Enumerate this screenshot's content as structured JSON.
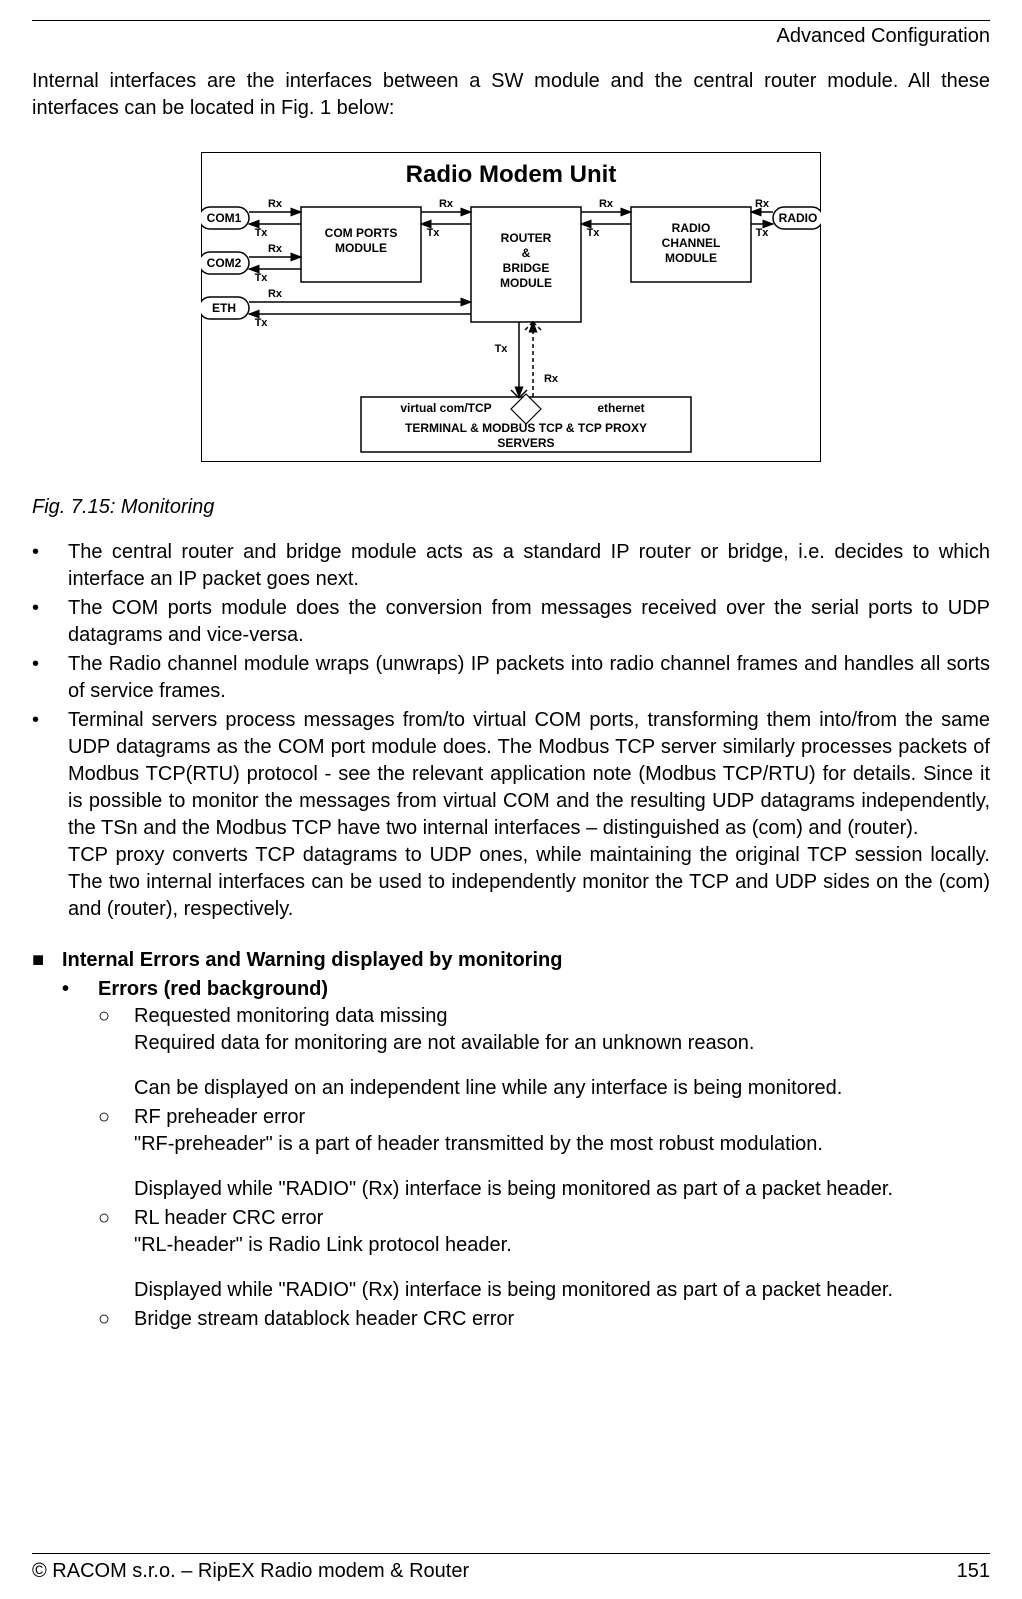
{
  "header": "Advanced Configuration",
  "intro": "Internal interfaces are the interfaces between a SW module and the central router module. All these interfaces can be located in Fig. 1 below:",
  "figure": {
    "title": "Radio Modem Unit",
    "ports": {
      "com1": "COM1",
      "com2": "COM2",
      "eth": "ETH",
      "radio": "RADIO"
    },
    "modules": {
      "com_ports": "COM PORTS MODULE",
      "router": "ROUTER & BRIDGE MODULE",
      "radio_channel": "RADIO CHANNEL MODULE",
      "servers": "TERMINAL & MODBUS TCP & TCP PROXY SERVERS"
    },
    "labels": {
      "rx": "Rx",
      "tx": "Tx",
      "virtual": "virtual com/TCP",
      "ethernet": "ethernet"
    },
    "caption": "Fig. 7.15: Monitoring"
  },
  "bullets": [
    "The central router and bridge module acts as a standard IP router or bridge, i.e. decides to which interface an IP packet goes next.",
    "The COM ports module does the conversion from messages received over the serial ports to UDP datagrams and vice-versa.",
    "The Radio channel module wraps (unwraps) IP packets into radio channel frames and handles all sorts of service frames.",
    "Terminal servers process messages from/to virtual COM ports, transforming them into/from the same UDP datagrams as the COM port module does. The Modbus TCP server similarly processes packets of Modbus TCP(RTU) protocol - see the relevant application note (Modbus TCP/RTU) for details. Since it is possible to monitor the messages from virtual COM and the resulting UDP datagrams independently, the TSn and the Modbus TCP have two internal interfaces – distinguished as (com) and (router).",
    "TCP proxy converts TCP datagrams to UDP ones, while maintaining the original TCP session locally. The two internal interfaces can be used to independently monitor the TCP and UDP sides on the (com) and (router), respectively."
  ],
  "section": {
    "heading": "Internal Errors and Warning displayed by monitoring",
    "sub": "Errors (red background)",
    "items": [
      {
        "title": "Requested monitoring data missing",
        "line1": "Required data for monitoring are not available for an unknown reason.",
        "line2": "Can be displayed on an independent line while any interface is being monitored."
      },
      {
        "title": "RF preheader error",
        "line1": "\"RF-preheader\" is a part of header transmitted by the most robust modulation.",
        "line2": "Displayed while \"RADIO\" (Rx) interface is being monitored as part of a packet header."
      },
      {
        "title": "RL header CRC error",
        "line1": "\"RL-header\" is Radio Link protocol header.",
        "line2": "Displayed while \"RADIO\" (Rx) interface is being monitored as part of a packet header."
      },
      {
        "title": "Bridge stream datablock header CRC error"
      }
    ]
  },
  "footer": {
    "left": "© RACOM s.r.o. – RipEX Radio modem & Router",
    "right": "151"
  }
}
